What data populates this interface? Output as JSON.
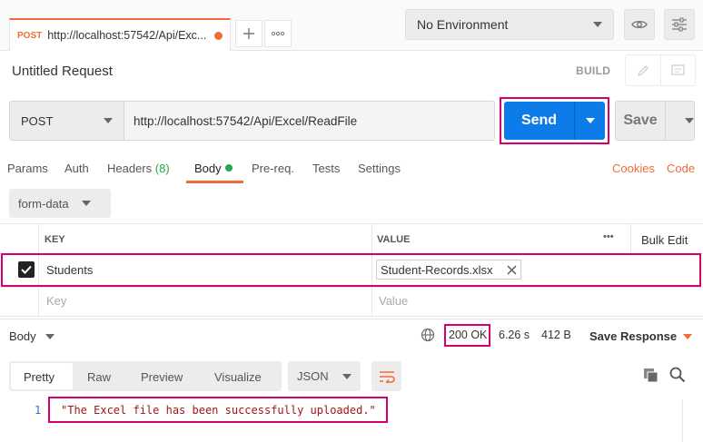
{
  "tab": {
    "method": "POST",
    "url": "http://localhost:57542/Api/Exc..."
  },
  "environment": {
    "selected": "No Environment"
  },
  "request": {
    "title": "Untitled Request",
    "build_label": "BUILD",
    "method": "POST",
    "url": "http://localhost:57542/Api/Excel/ReadFile",
    "send_label": "Send",
    "save_label": "Save"
  },
  "req_tabs": {
    "params": "Params",
    "auth": "Auth",
    "headers": "Headers",
    "headers_count": "(8)",
    "body": "Body",
    "prereq": "Pre-req.",
    "tests": "Tests",
    "settings": "Settings",
    "cookies": "Cookies",
    "code": "Code"
  },
  "body_mode": "form-data",
  "table": {
    "key_header": "KEY",
    "value_header": "VALUE",
    "more": "•••",
    "bulk_edit": "Bulk Edit",
    "rows": [
      {
        "key": "Students",
        "value": "Student-Records.xlsx",
        "checked": true
      }
    ],
    "key_placeholder": "Key",
    "value_placeholder": "Value"
  },
  "response": {
    "label": "Body",
    "status": "200 OK",
    "time": "6.26 s",
    "size": "412 B",
    "save_response": "Save Response",
    "tabs": [
      "Pretty",
      "Raw",
      "Preview",
      "Visualize"
    ],
    "format": "JSON",
    "line_number": "1",
    "body_text": "\"The Excel file has been successfully uploaded.\""
  },
  "colors": {
    "accent": "#f26b3a",
    "send": "#0d7ce8",
    "success": "#26a650",
    "highlight": "#d4006f"
  }
}
